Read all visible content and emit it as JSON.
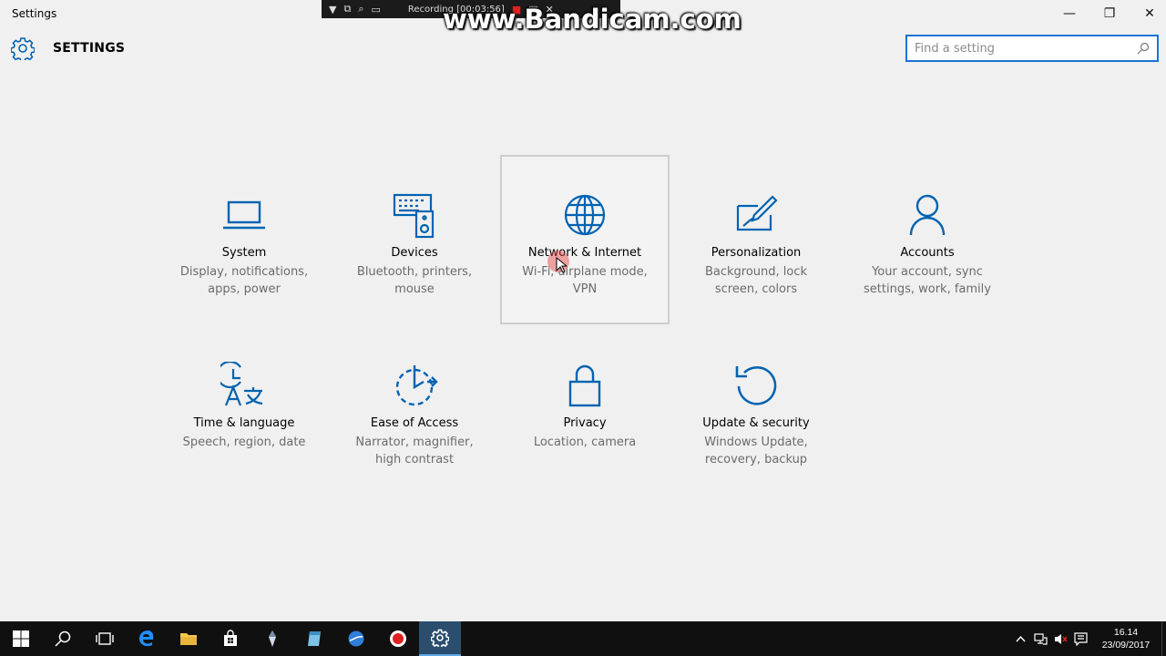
{
  "window": {
    "title": "Settings",
    "minimize_glyph": "—",
    "maximize_glyph": "❐",
    "close_glyph": "✕"
  },
  "recorder": {
    "status": "Recording [00:03:56]",
    "watermark": "www.Bandicam.com"
  },
  "header": {
    "title": "SETTINGS",
    "search_placeholder": "Find a setting"
  },
  "colors": {
    "accent": "#0063b1",
    "background": "#f0f0f0",
    "taskbar": "#101010"
  },
  "tiles": [
    {
      "name": "System",
      "desc": "Display, notifications, apps, power",
      "icon": "laptop-icon"
    },
    {
      "name": "Devices",
      "desc": "Bluetooth, printers, mouse",
      "icon": "devices-icon"
    },
    {
      "name": "Network & Internet",
      "desc": "Wi-Fi, airplane mode, VPN",
      "icon": "globe-icon"
    },
    {
      "name": "Personalization",
      "desc": "Background, lock screen, colors",
      "icon": "personalization-icon"
    },
    {
      "name": "Accounts",
      "desc": "Your account, sync settings, work, family",
      "icon": "person-icon"
    },
    {
      "name": "Time & language",
      "desc": "Speech, region, date",
      "icon": "time-language-icon"
    },
    {
      "name": "Ease of Access",
      "desc": "Narrator, magnifier, high contrast",
      "icon": "ease-of-access-icon"
    },
    {
      "name": "Privacy",
      "desc": "Location, camera",
      "icon": "lock-icon"
    },
    {
      "name": "Update & security",
      "desc": "Windows Update, recovery, backup",
      "icon": "update-icon"
    }
  ],
  "taskbar": {
    "apps": [
      "windows-start-icon",
      "search-icon",
      "task-view-icon",
      "edge-icon",
      "file-explorer-icon",
      "store-icon",
      "app-icon",
      "app-icon",
      "globe-app-icon",
      "bandicam-icon",
      "settings-gear-icon"
    ],
    "clock_time": "16.14",
    "clock_date": "23/09/2017"
  }
}
